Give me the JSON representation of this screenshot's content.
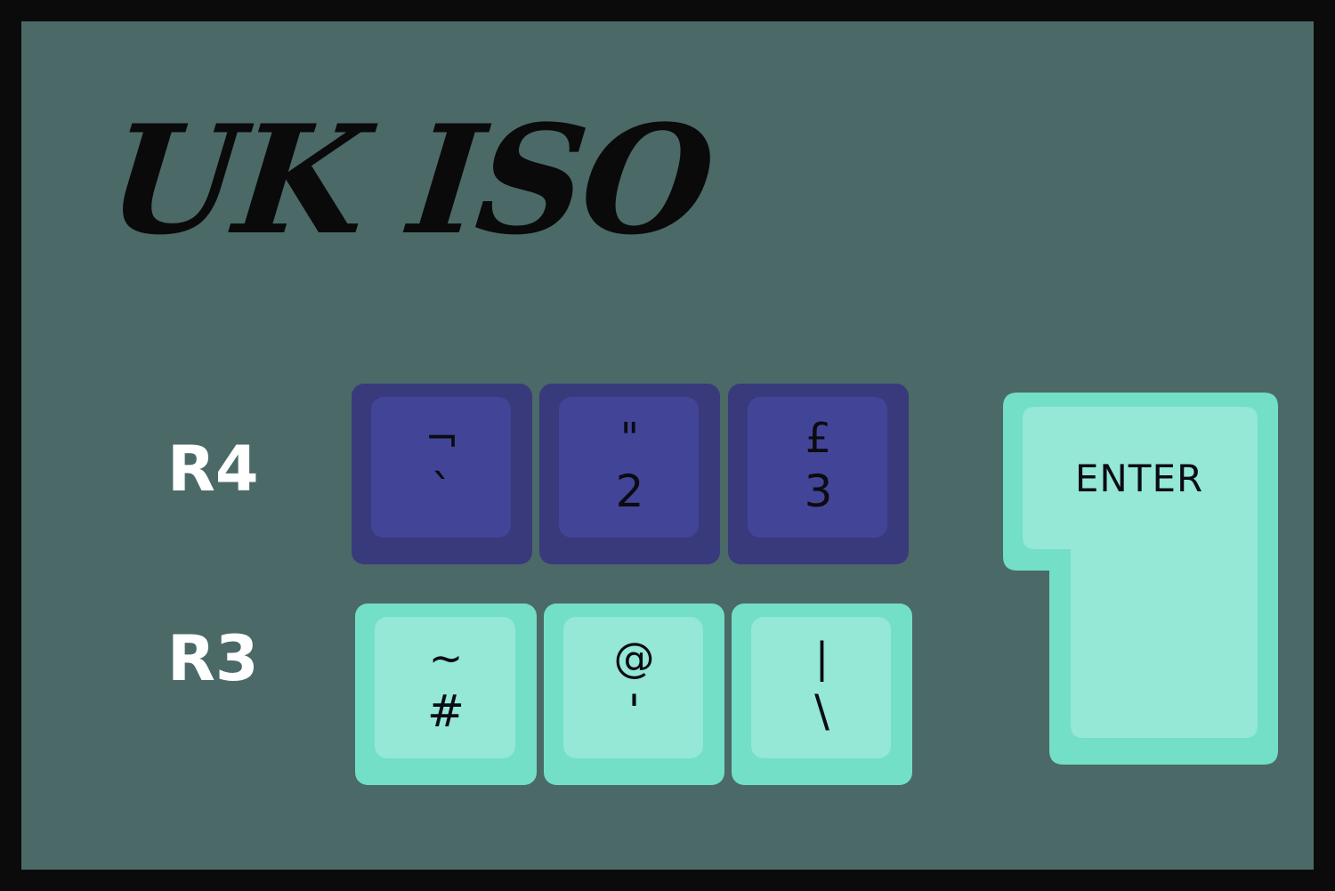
{
  "title": "UK ISO",
  "rows": [
    {
      "label": "R4"
    },
    {
      "label": "R3"
    }
  ],
  "keys": {
    "r4": [
      {
        "top": "¬",
        "bottom": "`"
      },
      {
        "top": "\"",
        "bottom": "2"
      },
      {
        "top": "£",
        "bottom": "3"
      }
    ],
    "r3": [
      {
        "top": "~",
        "bottom": "#"
      },
      {
        "top": "@",
        "bottom": "'"
      },
      {
        "top": "|",
        "bottom": "\\"
      }
    ]
  },
  "enter": {
    "label": "ENTER"
  },
  "colors": {
    "background": "#4b6967",
    "frame": "#0b0b0b",
    "dark_key_outer": "#383a7c",
    "dark_key_inner": "#424597",
    "mint_key_outer": "#72dfc6",
    "mint_key_inner": "#94e8d5"
  }
}
